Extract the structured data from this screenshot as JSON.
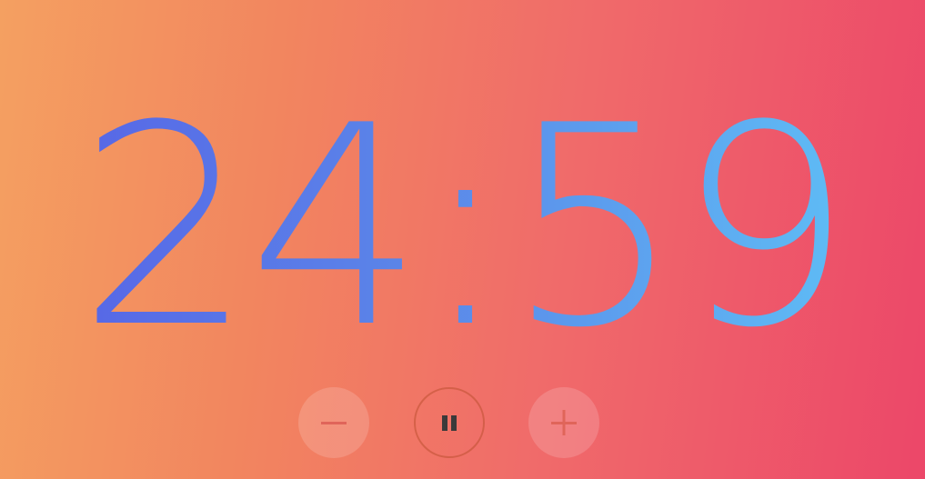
{
  "timer": {
    "display": "24:59"
  },
  "controls": {
    "decrease": {
      "icon": "minus-icon"
    },
    "toggle": {
      "icon": "pause-icon"
    },
    "increase": {
      "icon": "plus-icon"
    }
  },
  "colors": {
    "background_start": "#f4a061",
    "background_end": "#ec4769",
    "timer_start": "#5660e6",
    "timer_end": "#5fc6f7",
    "icon_faded": "#e0655a",
    "icon_strong": "#3a3a3a"
  }
}
